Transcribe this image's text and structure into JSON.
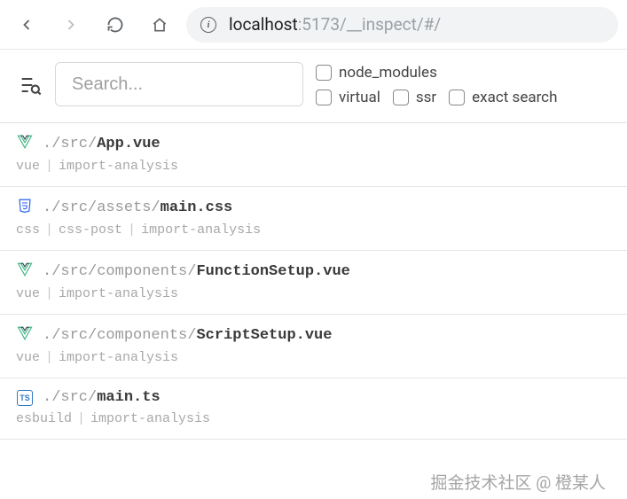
{
  "browser": {
    "url_host": "localhost",
    "url_port": ":5173",
    "url_path": "/__inspect/#/"
  },
  "search": {
    "placeholder": "Search..."
  },
  "filters": {
    "node_modules": "node_modules",
    "virtual": "virtual",
    "ssr": "ssr",
    "exact_search": "exact search"
  },
  "files": [
    {
      "icon": "vue",
      "prefix": "./src/",
      "name": "App.vue",
      "plugins": [
        "vue",
        "import-analysis"
      ]
    },
    {
      "icon": "css",
      "prefix": "./src/assets/",
      "name": "main.css",
      "plugins": [
        "css",
        "css-post",
        "import-analysis"
      ]
    },
    {
      "icon": "vue",
      "prefix": "./src/components/",
      "name": "FunctionSetup.vue",
      "plugins": [
        "vue",
        "import-analysis"
      ]
    },
    {
      "icon": "vue",
      "prefix": "./src/components/",
      "name": "ScriptSetup.vue",
      "plugins": [
        "vue",
        "import-analysis"
      ]
    },
    {
      "icon": "ts",
      "prefix": "./src/",
      "name": "main.ts",
      "plugins": [
        "esbuild",
        "import-analysis"
      ]
    }
  ],
  "watermark": "掘金技术社区 @ 橙某人"
}
